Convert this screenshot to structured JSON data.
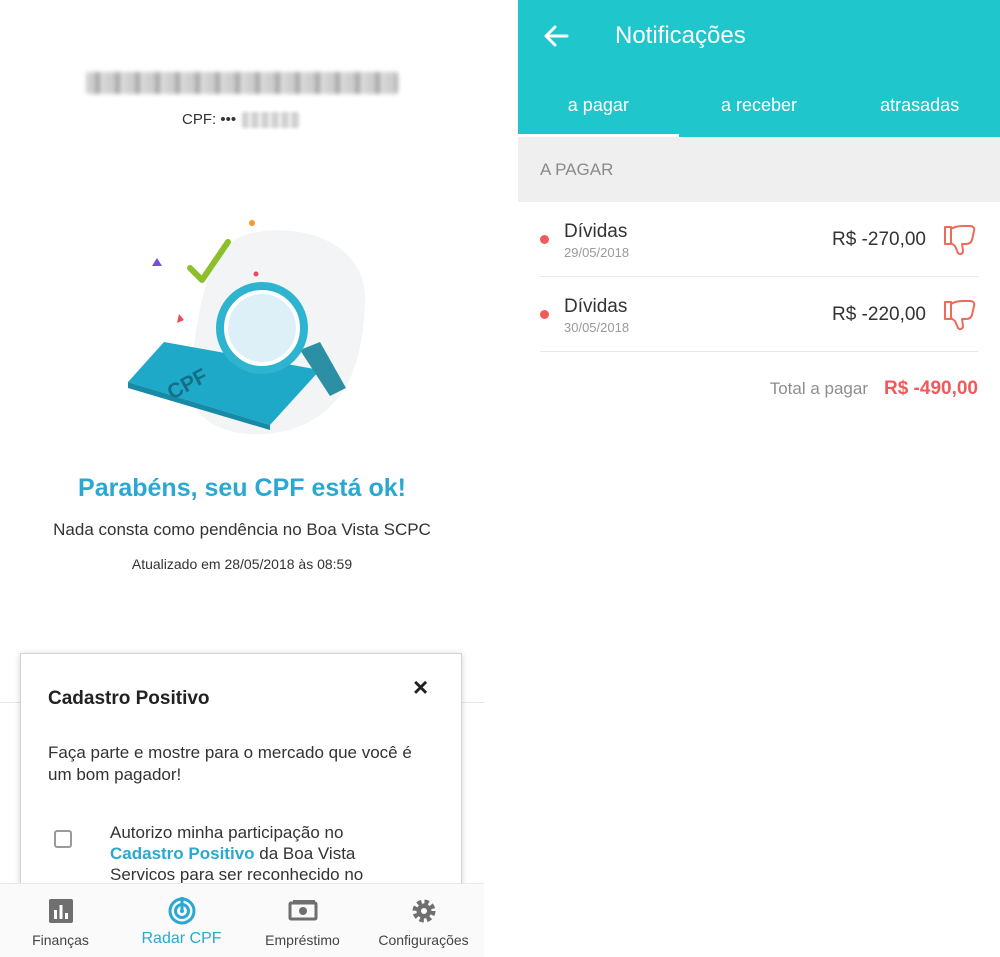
{
  "left": {
    "user_name_redacted": "",
    "cpf_label": "CPF: •••",
    "congrats_title": "Parabéns, seu CPF está ok!",
    "subtitle": "Nada consta como pendência no Boa Vista SCPC",
    "updated": "Atualizado em 28/05/2018 às 08:59",
    "illustration_card_text": "CPF",
    "modal": {
      "title": "Cadastro Positivo",
      "close": "×",
      "text": "Faça parte e mostre para o mercado que você é um bom pagador!",
      "consent_before": "Autorizo minha participação no",
      "consent_link": "Cadastro Positivo",
      "consent_after": "da Boa Vista Servicos para ser reconhecido no",
      "checkbox_checked": false
    },
    "bottom_nav": [
      {
        "label": "Finanças",
        "icon": "bar-chart-icon",
        "active": false
      },
      {
        "label": "Radar CPF",
        "icon": "radar-icon",
        "active": true
      },
      {
        "label": "Empréstimo",
        "icon": "money-icon",
        "active": false
      },
      {
        "label": "Configurações",
        "icon": "gear-icon",
        "active": false
      }
    ]
  },
  "right": {
    "title": "Notificações",
    "tabs": [
      {
        "label": "a pagar",
        "active": true
      },
      {
        "label": "a receber",
        "active": false
      },
      {
        "label": "atrasadas",
        "active": false
      }
    ],
    "section_header": "A PAGAR",
    "items": [
      {
        "title": "Dívidas",
        "date": "29/05/2018",
        "amount": "R$ -270,00"
      },
      {
        "title": "Dívidas",
        "date": "30/05/2018",
        "amount": "R$ -220,00"
      }
    ],
    "total_label": "Total a pagar",
    "total_value": "R$ -490,00"
  },
  "colors": {
    "accent": "#1fc6cb",
    "link": "#2aa8d2",
    "negative": "#ef5a5a"
  }
}
